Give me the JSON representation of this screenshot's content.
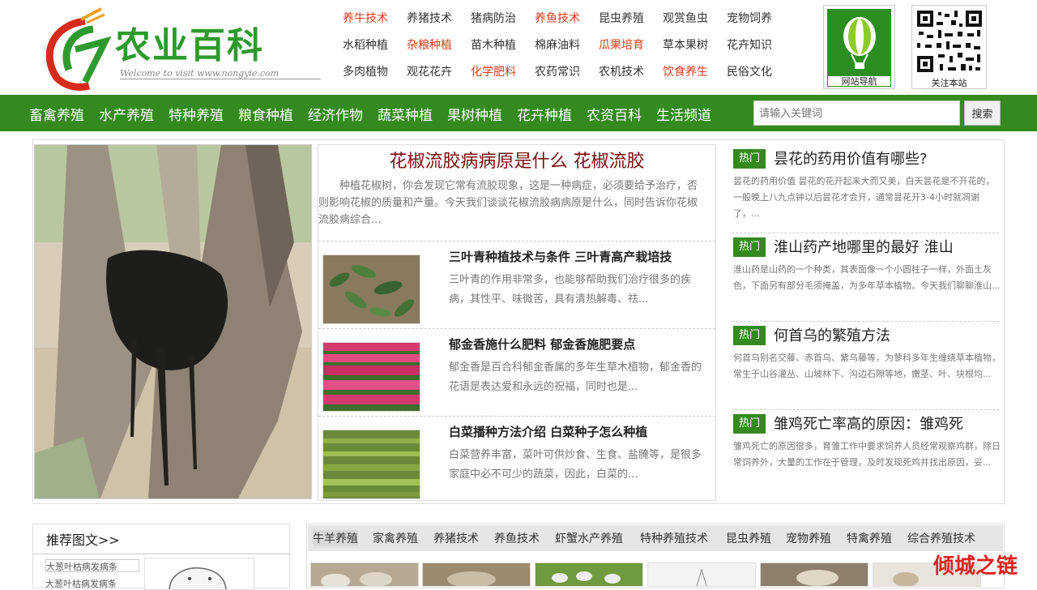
{
  "logo": {
    "title": "农业百科",
    "subtitle": "Welcome to visit www.nongyie.com"
  },
  "top_links": [
    {
      "label": "养牛技术",
      "red": true
    },
    {
      "label": "养猪技术",
      "red": false
    },
    {
      "label": "猪病防治",
      "red": false
    },
    {
      "label": "养鱼技术",
      "red": true
    },
    {
      "label": "昆虫养殖",
      "red": false
    },
    {
      "label": "观赏鱼虫",
      "red": false
    },
    {
      "label": "宠物饲养",
      "red": false
    },
    {
      "label": "水稻种植",
      "red": false
    },
    {
      "label": "杂粮种植",
      "red": true
    },
    {
      "label": "苗木种植",
      "red": false
    },
    {
      "label": "棉麻油料",
      "red": false
    },
    {
      "label": "瓜果培育",
      "red": true
    },
    {
      "label": "草本果树",
      "red": false
    },
    {
      "label": "花卉知识",
      "red": false
    },
    {
      "label": "多肉植物",
      "red": false
    },
    {
      "label": "观花花卉",
      "red": false
    },
    {
      "label": "化学肥料",
      "red": true
    },
    {
      "label": "农药常识",
      "red": false
    },
    {
      "label": "农机技术",
      "red": false
    },
    {
      "label": "饮食养生",
      "red": true
    },
    {
      "label": "民俗文化",
      "red": false
    }
  ],
  "site_nav_caption": "网站导航",
  "qr_caption": "关注本站",
  "main_nav": [
    "畜禽养殖",
    "水产养殖",
    "特种养殖",
    "粮食种植",
    "经济作物",
    "蔬菜种植",
    "果树种植",
    "花卉种植",
    "农资百科",
    "生活频道"
  ],
  "search": {
    "placeholder": "请输入关键词",
    "button": "搜索"
  },
  "feature": {
    "title": "花椒流胶病病原是什么 花椒流胶",
    "desc": "种植花椒树，你会发现它常有流胶现象，这是一种病症，必须要给予治疗，否则影响花椒的质量和产量。今天我们谈谈花椒流胶病病原是什么，同时告诉你花椒流胶病综合..."
  },
  "articles": [
    {
      "title": "三叶青种植技术与条件 三叶青高产栽培技",
      "desc": "三叶青的作用非常多，也能够帮助我们治疗很多的疾病，其性平、味微苦，具有清热解毒、祛..."
    },
    {
      "title": "郁金香施什么肥料 郁金香施肥要点",
      "desc": "郁金香是百合科郁金香属的多年生草木植物，郁金香的花语是表达爱和永远的祝福，同时也是..."
    },
    {
      "title": "白菜播种方法介绍 白菜种子怎么种植",
      "desc": "白菜营养丰富，菜叶可供炒食、生食、盐腌等，是很多家庭中必不可少的蔬菜，因此，白菜的..."
    }
  ],
  "hot_badge": "热门",
  "hot": [
    {
      "title": "昙花的药用价值有哪些?",
      "desc": "昙花的药用价值 昙花的花开起来大而又美，白天昙花是不开花的，一般晚上八九点钟以后昙花才会开，通常昙花开3-4小时就凋谢了，..."
    },
    {
      "title": "淮山药产地哪里的最好 淮山",
      "desc": "淮山药是山药的一个种类，其表面像一个小圆柱子一样，外面土灰色，下面另有部分毛须掩盖，为多年草本植物。今天我们聊聊淮山..."
    },
    {
      "title": "何首乌的繁殖方法",
      "desc": "何首乌别名交藤、赤首乌、紫乌藤等，为蓼科多年生缠绕草本植物，常生于山谷灌丛、山坡林下、沟边石隙等地，嫩茎、叶、块根均..."
    },
    {
      "title": "雏鸡死亡率高的原因：雏鸡死",
      "desc": "雏鸡死亡的原因很多，育雏工作中要求饲养人员经常观察鸡群，除日常饲养外，大量的工作在于管理，及时发现死鸡并找出原因，妥..."
    }
  ],
  "recommend": {
    "heading": "推荐图文>>",
    "alt1": "大葱叶枯病发病条",
    "alt2": "大葱叶枯病发病条"
  },
  "tabs": [
    "牛羊养殖",
    "家禽养殖",
    "养猪技术",
    "养鱼技术",
    "虾蟹水产养殖",
    "特种养殖技术",
    "昆虫养殖",
    "宠物养殖",
    "特禽养殖",
    "综合养殖技术"
  ],
  "watermark": "倾城之链"
}
